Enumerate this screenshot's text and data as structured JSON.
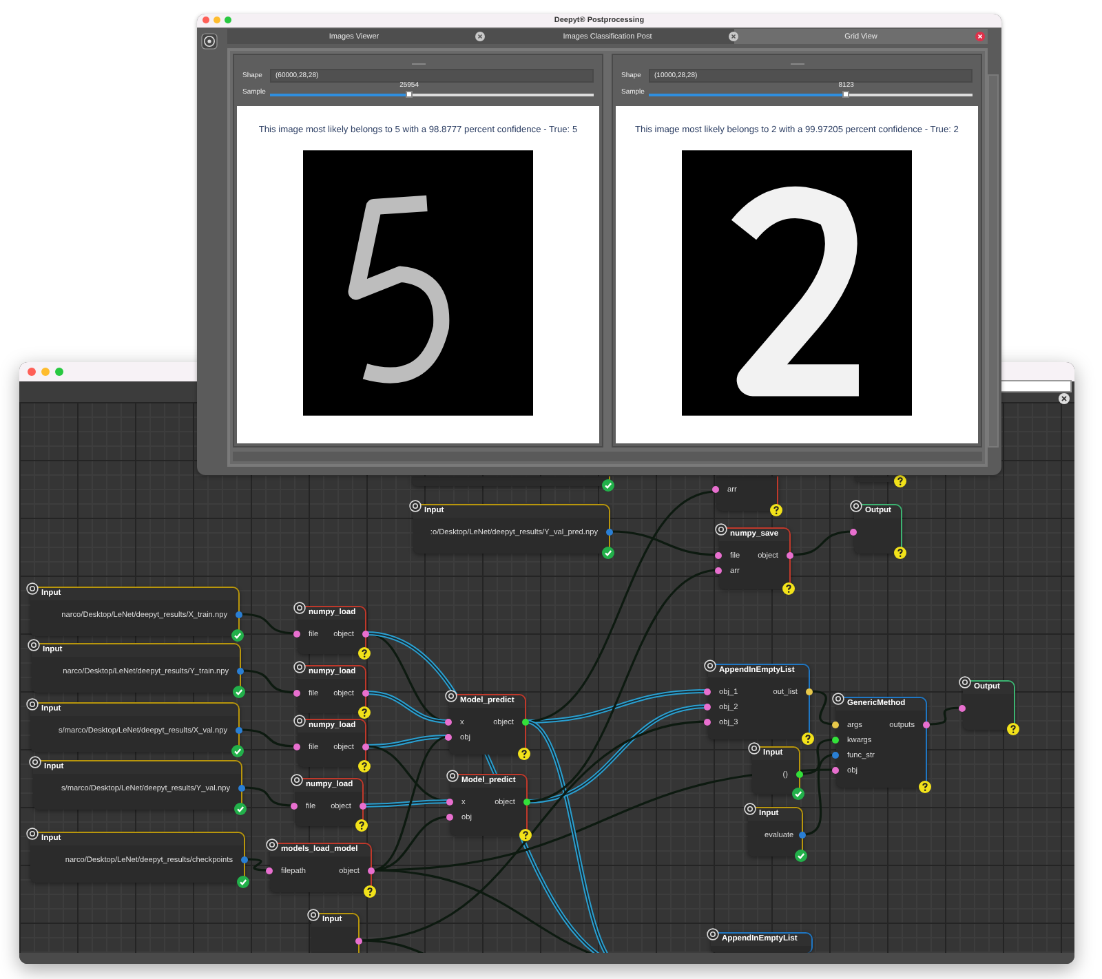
{
  "editor_window": {
    "nodes": [
      {
        "kind": "input",
        "valid": true
      },
      {
        "kind": "function",
        "valid": false,
        "inputs": [
          {
            "name": "arr",
            "color": "#e86fcf"
          }
        ]
      },
      {
        "kind": "output",
        "valid": false
      },
      {
        "kind": "input",
        "title": "Input",
        "color": "#b8960c",
        "valid": true,
        "value": ":o/Desktop/LeNet/deepyt_results/Y_val_pred.npy",
        "outputs": [
          {
            "color": "#2a7fd4"
          }
        ]
      },
      {
        "kind": "output",
        "title": "Output",
        "color": "#3cb371",
        "valid": false,
        "inputs": [
          {
            "color": "#e86fcf"
          }
        ]
      },
      {
        "kind": "function",
        "title": "numpy_save",
        "color": "#c0392b",
        "valid": false,
        "inputs": [
          {
            "name": "file",
            "color": "#e86fcf"
          },
          {
            "name": "arr",
            "color": "#e86fcf"
          }
        ],
        "outputs": [
          {
            "name": "object",
            "color": "#e86fcf"
          }
        ]
      },
      {
        "kind": "input",
        "title": "Input",
        "color": "#b8960c",
        "valid": true,
        "value": "narco/Desktop/LeNet/deepyt_results/X_train.npy",
        "outputs": [
          {
            "color": "#2a7fd4"
          }
        ]
      },
      {
        "kind": "function",
        "title": "numpy_load",
        "color": "#c0392b",
        "valid": false,
        "inputs": [
          {
            "name": "file",
            "color": "#e86fcf"
          }
        ],
        "outputs": [
          {
            "name": "object",
            "color": "#e86fcf"
          }
        ]
      },
      {
        "kind": "input",
        "title": "Input",
        "color": "#b8960c",
        "valid": true,
        "value": "narco/Desktop/LeNet/deepyt_results/Y_train.npy",
        "outputs": [
          {
            "color": "#2a7fd4"
          }
        ]
      },
      {
        "kind": "function",
        "title": "numpy_load",
        "color": "#c0392b",
        "valid": false,
        "inputs": [
          {
            "name": "file",
            "color": "#e86fcf"
          }
        ],
        "outputs": [
          {
            "name": "object",
            "color": "#e86fcf"
          }
        ]
      },
      {
        "kind": "function",
        "title": "AppendInEmptyList",
        "color": "#1f77c4",
        "valid": false,
        "inputs": [
          {
            "name": "obj_1",
            "color": "#e86fcf"
          },
          {
            "name": "obj_2",
            "color": "#e86fcf"
          },
          {
            "name": "obj_3",
            "color": "#e86fcf"
          }
        ],
        "outputs": [
          {
            "name": "out_list",
            "color": "#e8c84a"
          }
        ]
      },
      {
        "kind": "output",
        "title": "Output",
        "color": "#3cb371",
        "valid": false,
        "inputs": [
          {
            "color": "#e86fcf"
          }
        ]
      },
      {
        "kind": "input",
        "title": "Input",
        "color": "#b8960c",
        "valid": true,
        "value": "s/marco/Desktop/LeNet/deepyt_results/X_val.npy",
        "outputs": [
          {
            "color": "#2a7fd4"
          }
        ]
      },
      {
        "kind": "function",
        "title": "Model_predict",
        "color": "#c0392b",
        "valid": false,
        "inputs": [
          {
            "name": "x",
            "color": "#e86fcf"
          },
          {
            "name": "obj",
            "color": "#e86fcf"
          }
        ],
        "outputs": [
          {
            "name": "object",
            "color": "#33e03a"
          }
        ]
      },
      {
        "kind": "function",
        "title": "numpy_load",
        "color": "#c0392b",
        "valid": false,
        "inputs": [
          {
            "name": "file",
            "color": "#e86fcf"
          }
        ],
        "outputs": [
          {
            "name": "object",
            "color": "#e86fcf"
          }
        ]
      },
      {
        "kind": "function",
        "title": "GenericMethod",
        "color": "#1f77c4",
        "valid": false,
        "inputs": [
          {
            "name": "args",
            "color": "#e8c84a"
          },
          {
            "name": "kwargs",
            "color": "#33e03a"
          },
          {
            "name": "func_str",
            "color": "#2a7fd4"
          },
          {
            "name": "obj",
            "color": "#e86fcf"
          }
        ],
        "outputs": [
          {
            "name": "outputs",
            "color": "#e86fcf"
          }
        ]
      },
      {
        "kind": "input",
        "title": "Input",
        "color": "#b8960c",
        "valid": true,
        "value": "()",
        "outputs": [
          {
            "color": "#33e03a"
          }
        ]
      },
      {
        "kind": "input",
        "title": "Input",
        "color": "#b8960c",
        "valid": true,
        "value": "s/marco/Desktop/LeNet/deepyt_results/Y_val.npy",
        "outputs": [
          {
            "color": "#2a7fd4"
          }
        ]
      },
      {
        "kind": "function",
        "title": "numpy_load",
        "color": "#c0392b",
        "valid": false,
        "inputs": [
          {
            "name": "file",
            "color": "#e86fcf"
          }
        ],
        "outputs": [
          {
            "name": "object",
            "color": "#e86fcf"
          }
        ]
      },
      {
        "kind": "function",
        "title": "Model_predict",
        "color": "#c0392b",
        "valid": false,
        "inputs": [
          {
            "name": "x",
            "color": "#e86fcf"
          },
          {
            "name": "obj",
            "color": "#e86fcf"
          }
        ],
        "outputs": [
          {
            "name": "object",
            "color": "#33e03a"
          }
        ]
      },
      {
        "kind": "input",
        "title": "Input",
        "color": "#b8960c",
        "valid": true,
        "value": "evaluate",
        "outputs": [
          {
            "color": "#2a7fd4"
          }
        ]
      },
      {
        "kind": "input",
        "title": "Input",
        "color": "#b8960c",
        "valid": true,
        "value": "narco/Desktop/LeNet/deepyt_results/checkpoints",
        "outputs": [
          {
            "color": "#2a7fd4"
          }
        ]
      },
      {
        "kind": "function",
        "title": "models_load_model",
        "color": "#c0392b",
        "valid": false,
        "inputs": [
          {
            "name": "filepath",
            "color": "#e86fcf"
          }
        ],
        "outputs": [
          {
            "name": "object",
            "color": "#e86fcf"
          }
        ]
      },
      {
        "kind": "input",
        "title": "Input",
        "color": "#b8960c",
        "outputs": [
          {
            "color": "#e86fcf"
          }
        ]
      },
      {
        "kind": "function",
        "title": "AppendInEmptyList",
        "color": "#1f77c4"
      }
    ]
  },
  "postprocessing_window": {
    "title": "Deepyt® Postprocessing",
    "tabs": [
      {
        "label": "Images Viewer",
        "selected": false
      },
      {
        "label": "Images Classification Post",
        "selected": false
      },
      {
        "label": "Grid View",
        "selected": true
      }
    ],
    "panels": [
      {
        "shape_label": "Shape",
        "shape_value": "(60000,28,28)",
        "sample_label": "Sample",
        "sample_value": "25954",
        "level": 0.43,
        "caption": "This image most likely belongs to 5 with a 98.8777 percent confidence - True: 5"
      },
      {
        "shape_label": "Shape",
        "shape_value": "(10000,28,28)",
        "sample_label": "Sample",
        "sample_value": "8123",
        "level": 0.61,
        "caption": "This image most likely belongs to 2 with a 99.97205 percent confidence - True: 2"
      }
    ]
  }
}
